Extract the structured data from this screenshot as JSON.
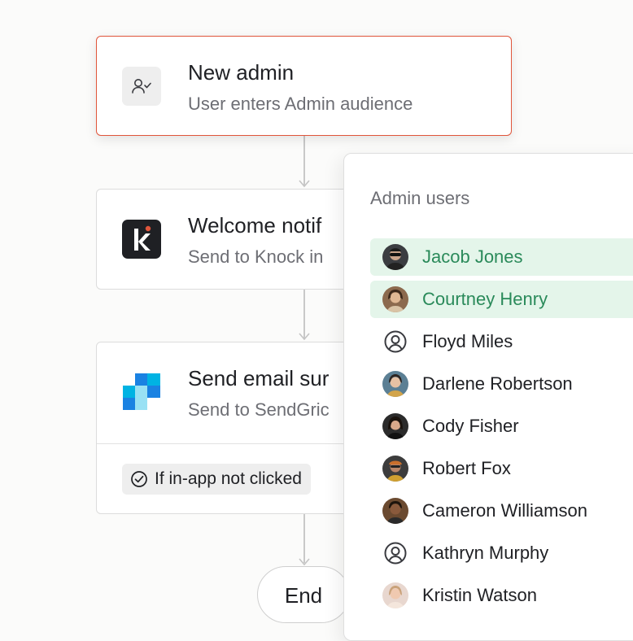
{
  "workflow": {
    "trigger": {
      "title": "New admin",
      "subtitle": "User enters Admin audience",
      "icon": "user-check-icon"
    },
    "steps": [
      {
        "title": "Welcome notif",
        "subtitle": "Send to Knock in",
        "icon": "knock-logo"
      },
      {
        "title": "Send email sur",
        "subtitle": "Send to SendGric",
        "icon": "sendgrid-logo",
        "condition": "If in-app not clicked"
      }
    ],
    "end_label": "End",
    "accent_color": "#e0553b"
  },
  "audience_panel": {
    "title": "Admin users",
    "users": [
      {
        "name": "Jacob Jones",
        "selected": true,
        "avatar": "photo"
      },
      {
        "name": "Courtney Henry",
        "selected": true,
        "avatar": "photo"
      },
      {
        "name": "Floyd Miles",
        "selected": false,
        "avatar": "user-circle-icon"
      },
      {
        "name": "Darlene Robertson",
        "selected": false,
        "avatar": "photo"
      },
      {
        "name": "Cody Fisher",
        "selected": false,
        "avatar": "photo"
      },
      {
        "name": "Robert Fox",
        "selected": false,
        "avatar": "photo"
      },
      {
        "name": "Cameron Williamson",
        "selected": false,
        "avatar": "photo"
      },
      {
        "name": "Kathryn Murphy",
        "selected": false,
        "avatar": "user-circle-icon"
      },
      {
        "name": "Kristin Watson",
        "selected": false,
        "avatar": "photo"
      }
    ],
    "selected_color": "#2a8a5a",
    "selected_bg": "#e4f5ea"
  }
}
